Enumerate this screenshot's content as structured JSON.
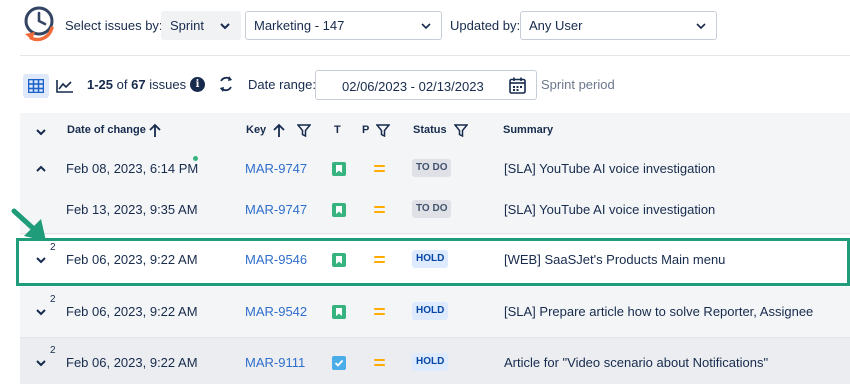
{
  "filters": {
    "select_by_label": "Select issues by:",
    "select_by_value": "Sprint",
    "sprint_value": "Marketing - 147",
    "updated_by_label": "Updated by:",
    "updated_by_value": "Any User"
  },
  "toolbar": {
    "count_range": "1-25",
    "count_of": "of",
    "count_total": "67",
    "count_suffix": "issues",
    "date_range_label": "Date range:",
    "date_range_value": "02/06/2023 - 02/13/2023",
    "sprint_period_label": "Sprint period"
  },
  "table": {
    "headers": {
      "date": "Date of change",
      "key": "Key",
      "type": "T",
      "priority": "P",
      "status": "Status",
      "summary": "Summary"
    },
    "rows": [
      {
        "date": "Feb 08, 2023, 6:14 PM",
        "key": "MAR-9747",
        "status": "TO DO",
        "summary": "[SLA] YouTube AI voice investigation"
      },
      {
        "date": "Feb 13, 2023, 9:35 AM",
        "key": "MAR-9747",
        "status": "TO DO",
        "summary": "[SLA] YouTube AI voice investigation"
      },
      {
        "date": "Feb 06, 2023, 9:22 AM",
        "key": "MAR-9546",
        "status": "HOLD",
        "summary": "[WEB] SaaSJet's Products Main menu",
        "sup": "2"
      },
      {
        "date": "Feb 06, 2023, 9:22 AM",
        "key": "MAR-9542",
        "status": "HOLD",
        "summary": "[SLA] Prepare article how to solve Reporter, Assignee",
        "sup": "2"
      },
      {
        "date": "Feb 06, 2023, 9:22 AM",
        "key": "MAR-9111",
        "status": "HOLD",
        "summary": "Article for \"Video scenario about Notifications\"",
        "sup": "2"
      }
    ]
  },
  "colors": {
    "accent": "#2f6fcb",
    "highlight": "#1f9c79",
    "story": "#36b37e",
    "task": "#4bade8",
    "priority_medium": "#ffab00"
  }
}
